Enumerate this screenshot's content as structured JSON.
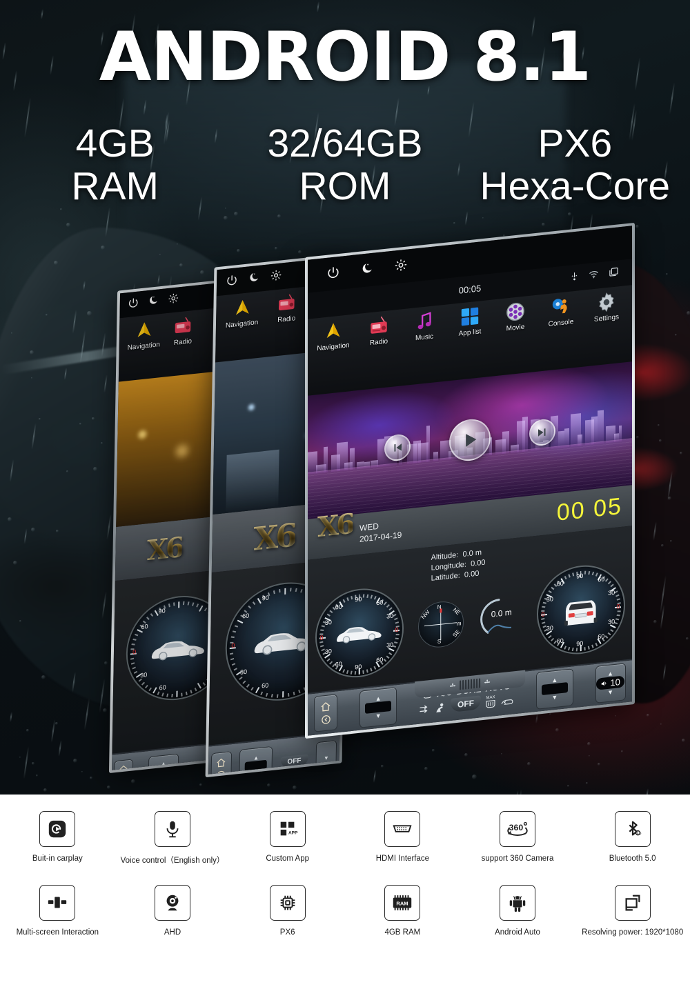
{
  "hero": {
    "title": "ANDROID 8.1",
    "specs": [
      {
        "line1": "4GB",
        "line2": "RAM"
      },
      {
        "line1": "32/64GB",
        "line2": "ROM"
      },
      {
        "line1": "PX6",
        "line2": "Hexa-Core"
      }
    ]
  },
  "head_unit": {
    "top_controls": [
      "power-icon",
      "night-mode-icon",
      "brightness-icon"
    ],
    "status": {
      "clock": "00:05",
      "right_icons": [
        "usb-icon",
        "wifi-icon",
        "recent-apps-icon"
      ]
    },
    "apps": [
      {
        "label": "Navigation",
        "icon": "navigation-arrow-icon"
      },
      {
        "label": "Radio",
        "icon": "radio-icon"
      },
      {
        "label": "Music",
        "icon": "music-note-icon"
      },
      {
        "label": "App list",
        "icon": "grid-apps-icon"
      },
      {
        "label": "Movie",
        "icon": "film-reel-icon"
      },
      {
        "label": "Console",
        "icon": "driver-console-icon"
      },
      {
        "label": "Settings",
        "icon": "gear-icon"
      }
    ],
    "player": {
      "prev": "previous-track-icon",
      "play": "play-icon",
      "next": "next-track-icon"
    },
    "info_bar": {
      "logo": "X6",
      "weekday": "WED",
      "date": "2017-04-19",
      "clock": "00 05"
    },
    "gps": {
      "altitude_label": "Altitude:",
      "altitude_value": "0.0 m",
      "longitude_label": "Longitude:",
      "longitude_value": "0.00",
      "latitude_label": "Latitude:",
      "latitude_value": "0.00"
    },
    "gauges": {
      "tick_numbers": [
        "30",
        "60",
        "90",
        "60",
        "30"
      ],
      "zero_label": "0",
      "altitude_readout": "0.0 m",
      "compass": {
        "n": "N",
        "s": "S",
        "nw": "NW",
        "ne": "NE",
        "se": "SE",
        "unit": "m"
      }
    },
    "climate": {
      "home": "home-icon",
      "back": "back-arrow-icon",
      "ac": "A/C",
      "dual": "DUAL",
      "auto": "AUTO",
      "off": "OFF",
      "max": "MAX",
      "volume": "10"
    }
  },
  "features": {
    "row1": [
      {
        "label": "Buit-in carplay",
        "icon": "carplay-icon"
      },
      {
        "label": "Voice control（English only）",
        "icon": "microphone-icon"
      },
      {
        "label": "Custom App",
        "icon": "custom-app-icon",
        "badge": "APP"
      },
      {
        "label": "HDMI Interface",
        "icon": "hdmi-port-icon"
      },
      {
        "label": "support 360 Camera",
        "icon": "camera-360-icon",
        "badge": "360"
      },
      {
        "label": "Bluetooth 5.0",
        "icon": "bluetooth-icon"
      }
    ],
    "row2": [
      {
        "label": "Multi-screen Interaction",
        "icon": "multi-screen-icon"
      },
      {
        "label": "AHD",
        "icon": "ahd-camera-icon"
      },
      {
        "label": "PX6",
        "icon": "chip-icon"
      },
      {
        "label": "4GB  RAM",
        "icon": "ram-chip-icon",
        "badge": "RAM"
      },
      {
        "label": "Android Auto",
        "icon": "android-robot-icon"
      },
      {
        "label": "Resolving power: 1920*1080",
        "icon": "resolution-icon"
      }
    ]
  },
  "colors": {
    "accent_yellow": "#f5f53a",
    "gold": "#d4b25a",
    "hero_bg": "#0a0f12",
    "feature_stroke": "#2a2a2a"
  }
}
